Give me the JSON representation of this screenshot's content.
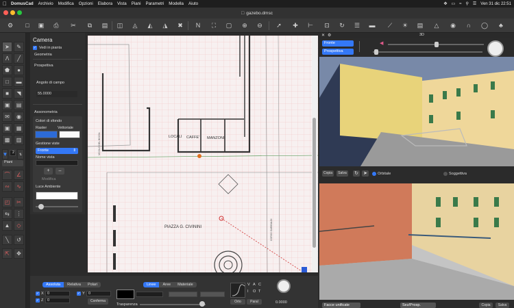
{
  "menubar": {
    "app": "DomusCad",
    "items": [
      "Archivio",
      "Modifica",
      "Opzioni",
      "Elabora",
      "Vista",
      "Piani",
      "Parametri",
      "Modella",
      "Aiuto"
    ],
    "datetime": "Ven 31 dic  22:51"
  },
  "window": {
    "title": "gazebo.dmsc"
  },
  "tabs": {
    "floor_num": "1",
    "view3d": "3D"
  },
  "panel": {
    "title": "Camera",
    "show_plan": "Vedi in pianta",
    "geometry": "Geometria",
    "perspective": "Prospettiva",
    "angle_label": "Angolo di campo",
    "angle_value": "55.0000",
    "axonometry": "Assonometria",
    "bg_colors": "Colori di sfondo",
    "raster": "Raster",
    "vector": "Vettoriale",
    "view_mgmt": "Gestione viste",
    "view_select": "Fronte",
    "view_name": "Nome vista",
    "modify": "Modifica",
    "ambient": "Luce Ambiente"
  },
  "left": {
    "floor_value": "2",
    "floor_select": "Piani"
  },
  "plan": {
    "label_locali": "LOCALI",
    "label_caffe": "CAFFE'",
    "label_manzoni": "MANZONI",
    "label_piazza": "PIAZZA G. CIVININI",
    "label_corso": "CORSO GARIBALDI",
    "label_vicolo": "VICOLO DEL BOZZA"
  },
  "view3d": {
    "view_select": "Fronte",
    "proj_select": "Prospettiva",
    "copy": "Copia",
    "save": "Salva",
    "orbit": "Orbitale",
    "subjective": "Soggettiva",
    "faces_select": "Facce unificate",
    "sun_select": "Sez/Prosp.",
    "copy_bottom": "Copia",
    "save_bottom": "Salva"
  },
  "bottom": {
    "coord_tabs": [
      "Assoluta",
      "Relativa",
      "Polari"
    ],
    "x_label": "X",
    "x_value": "0",
    "y_label": "Y",
    "y_value": "0",
    "z_label": "Z",
    "z_value": "0",
    "confirm": "Conferma",
    "style_tabs": [
      "Linee",
      "Aree",
      "Materiale"
    ],
    "transparency": "Trasparenza",
    "ortho": "Orto",
    "paral": "Paral",
    "flags": [
      "V",
      "A",
      "C",
      "I",
      "O",
      "T"
    ],
    "dial_value": "0.0000"
  }
}
